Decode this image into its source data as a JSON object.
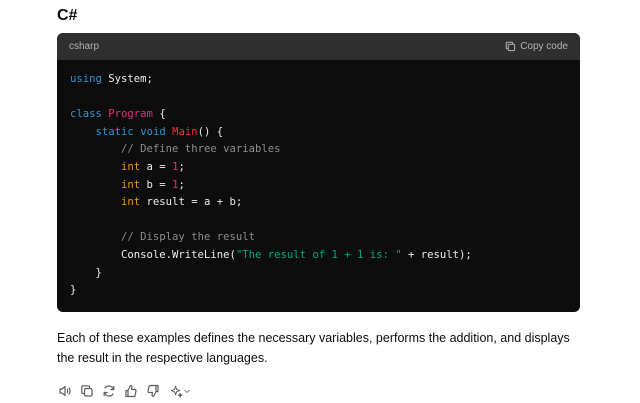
{
  "heading": "C#",
  "code_block": {
    "language": "csharp",
    "copy_label": "Copy code",
    "lines": [
      [
        {
          "t": "using",
          "c": "kw"
        },
        {
          "t": " System;",
          "c": ""
        }
      ],
      [],
      [
        {
          "t": "class",
          "c": "kw"
        },
        {
          "t": " ",
          "c": ""
        },
        {
          "t": "Program",
          "c": "cls"
        },
        {
          "t": " {",
          "c": ""
        }
      ],
      [
        {
          "t": "    ",
          "c": ""
        },
        {
          "t": "static",
          "c": "kw"
        },
        {
          "t": " ",
          "c": ""
        },
        {
          "t": "void",
          "c": "kw"
        },
        {
          "t": " ",
          "c": ""
        },
        {
          "t": "Main",
          "c": "fn"
        },
        {
          "t": "() {",
          "c": ""
        }
      ],
      [
        {
          "t": "        ",
          "c": ""
        },
        {
          "t": "// Define three variables",
          "c": "cm"
        }
      ],
      [
        {
          "t": "        ",
          "c": ""
        },
        {
          "t": "int",
          "c": "ty"
        },
        {
          "t": " a = ",
          "c": ""
        },
        {
          "t": "1",
          "c": "num"
        },
        {
          "t": ";",
          "c": ""
        }
      ],
      [
        {
          "t": "        ",
          "c": ""
        },
        {
          "t": "int",
          "c": "ty"
        },
        {
          "t": " b = ",
          "c": ""
        },
        {
          "t": "1",
          "c": "num"
        },
        {
          "t": ";",
          "c": ""
        }
      ],
      [
        {
          "t": "        ",
          "c": ""
        },
        {
          "t": "int",
          "c": "ty"
        },
        {
          "t": " result = a + b;",
          "c": ""
        }
      ],
      [],
      [
        {
          "t": "        ",
          "c": ""
        },
        {
          "t": "// Display the result",
          "c": "cm"
        }
      ],
      [
        {
          "t": "        Console.WriteLine(",
          "c": ""
        },
        {
          "t": "\"The result of 1 + 1 is: \"",
          "c": "str"
        },
        {
          "t": " + result);",
          "c": ""
        }
      ],
      [
        {
          "t": "    }",
          "c": ""
        }
      ],
      [
        {
          "t": "}",
          "c": ""
        }
      ]
    ]
  },
  "paragraph": "Each of these examples defines the necessary variables, performs the addition, and displays the result in the respective languages.",
  "actions": [
    {
      "name": "read-aloud-button",
      "icon": "speaker-icon"
    },
    {
      "name": "copy-button",
      "icon": "copy-icon"
    },
    {
      "name": "regenerate-button",
      "icon": "refresh-icon"
    },
    {
      "name": "thumbs-up-button",
      "icon": "thumbs-up-icon"
    },
    {
      "name": "thumbs-down-button",
      "icon": "thumbs-down-icon"
    },
    {
      "name": "change-model-button",
      "icon": "sparkle-icon"
    }
  ],
  "colors": {
    "code_bg": "#0d0d0d",
    "code_header_bg": "#2f2f2f",
    "keyword": "#2e95d3",
    "class_name": "#df3079",
    "function_name": "#f22c3d",
    "type": "#e9950c",
    "number": "#df3079",
    "comment": "#8d8d8d",
    "string": "#00a67d"
  }
}
